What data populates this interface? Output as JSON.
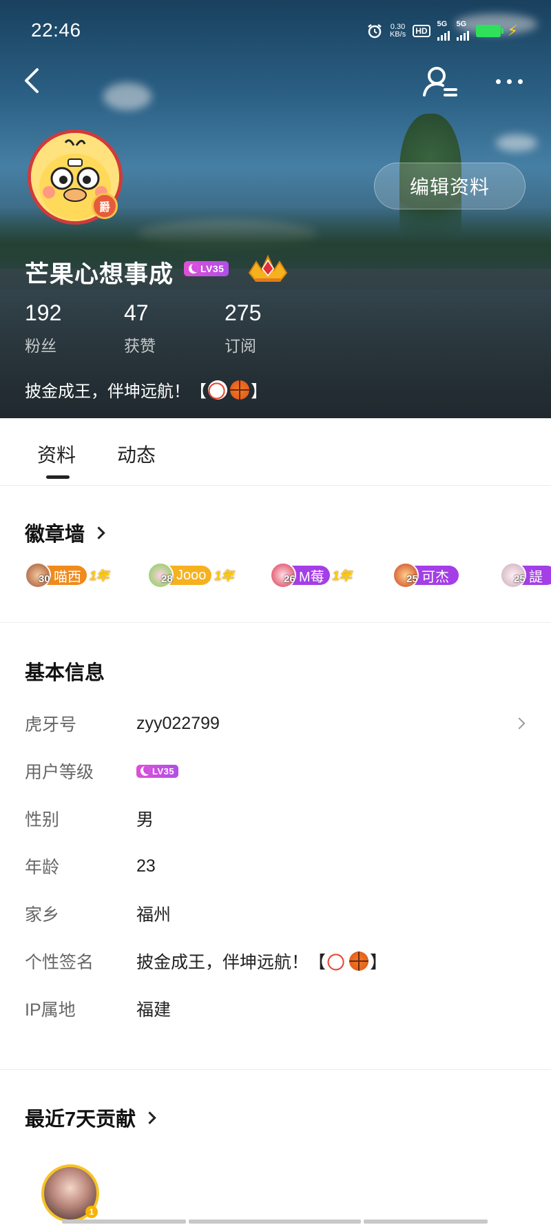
{
  "status_bar": {
    "time": "22:46",
    "net_speed_value": "0.30",
    "net_speed_unit": "KB/s",
    "hd_label": "HD",
    "sim1": "5G",
    "sim2": "5G"
  },
  "profile": {
    "username": "芒果心想事成",
    "level_badge": "LV35",
    "noble_badge_char": "爵",
    "edit_button": "编辑资料",
    "bio_text": "披金成王，伴坤远航！【",
    "bio_close": "】",
    "stats": [
      {
        "value": "192",
        "label": "粉丝"
      },
      {
        "value": "47",
        "label": "获赞"
      },
      {
        "value": "275",
        "label": "订阅"
      }
    ]
  },
  "tabs": [
    {
      "label": "资料",
      "active": true
    },
    {
      "label": "动态",
      "active": false
    }
  ],
  "badge_wall": {
    "title": "徽章墙",
    "badges": [
      {
        "level": "30",
        "name": "喵西",
        "year_mark": "1年",
        "color": "#f08a1c"
      },
      {
        "level": "28",
        "name": "Jooo",
        "year_mark": "1年",
        "color": "#f6b11f"
      },
      {
        "level": "26",
        "name": "M莓",
        "year_mark": "1年",
        "color": "#a43ee6"
      },
      {
        "level": "25",
        "name": "可杰",
        "year_mark": "",
        "color": "#a43ee6"
      },
      {
        "level": "25",
        "name": "諟",
        "year_mark": "",
        "color": "#a43ee6"
      }
    ]
  },
  "basic_info": {
    "title": "基本信息",
    "rows": [
      {
        "key": "虎牙号",
        "value": "zyy022799"
      },
      {
        "key": "用户等级",
        "value": "LV35"
      },
      {
        "key": "性别",
        "value": "男"
      },
      {
        "key": "年龄",
        "value": "23"
      },
      {
        "key": "家乡",
        "value": "福州"
      },
      {
        "key": "个性签名",
        "value": "披金成王，伴坤远航！【",
        "value_close": "】"
      },
      {
        "key": "IP属地",
        "value": "福建"
      }
    ]
  },
  "contribution": {
    "title": "最近7天贡献",
    "rank": "1"
  },
  "colors": {
    "level_badge": "#d24fe0",
    "battery": "#2ee05a",
    "avatar_ring": "#d13a3a"
  }
}
